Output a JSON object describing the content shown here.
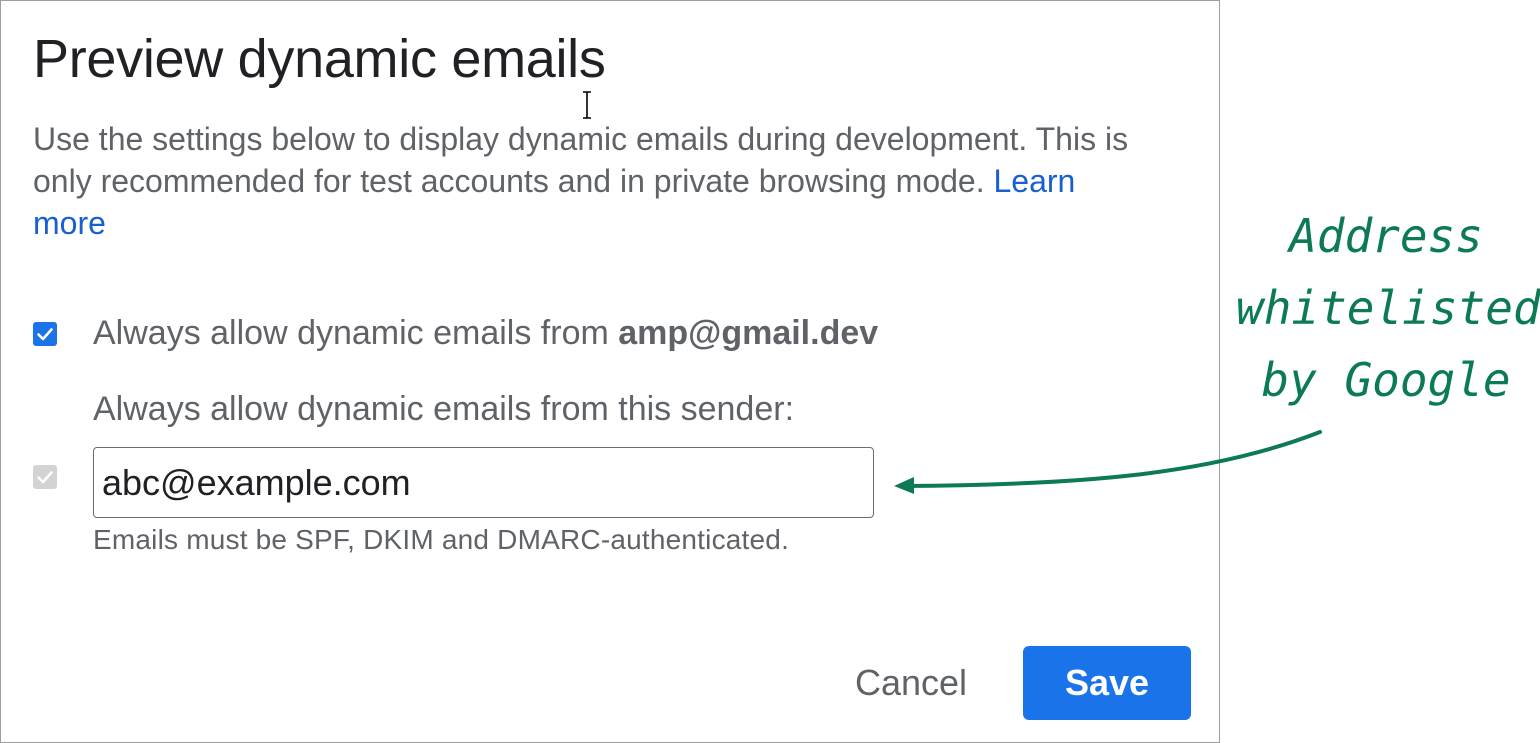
{
  "dialog": {
    "title": "Preview dynamic emails",
    "description": "Use the settings below to display dynamic emails during development. This is only recommended for test accounts and in private browsing mode.",
    "learn_more_label": "Learn more",
    "option_gmail": {
      "label_prefix": "Always allow dynamic emails from",
      "email": "amp@gmail.dev",
      "checked": true
    },
    "option_sender": {
      "label": "Always allow dynamic emails from this sender:",
      "checked": true,
      "disabled": true,
      "input_value": "abc@example.com",
      "hint": "Emails must be SPF, DKIM and DMARC-authenticated."
    },
    "buttons": {
      "cancel_label": "Cancel",
      "save_label": "Save"
    }
  },
  "annotation": {
    "line1": "Address",
    "line2": "whitelisted",
    "line3": "by Google",
    "color": "#0b7a55"
  },
  "colors": {
    "accent": "#1a73e8",
    "link": "#1a5fd0",
    "text_secondary": "#5f6368",
    "text_primary": "#202124"
  }
}
